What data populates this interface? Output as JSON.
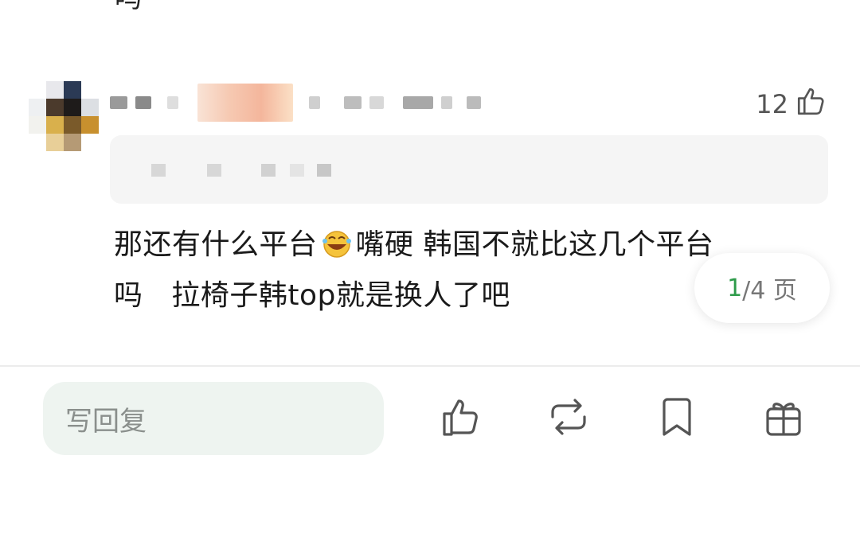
{
  "top_fragment": "吗",
  "comment": {
    "likes": "12",
    "text_before_emoji": "那还有什么平台",
    "text_after_emoji": "嘴硬 韩国不就比这几个平台\n吗   拉椅子韩top就是换人了吧",
    "emoji": "rolling-on-floor-laughing"
  },
  "pager": {
    "current": "1",
    "total": "/4 页"
  },
  "bottom_bar": {
    "reply_placeholder": "写回复",
    "actions": [
      "like-icon",
      "repost-icon",
      "bookmark-icon",
      "gift-icon"
    ]
  },
  "colors": {
    "accent_green": "#2e9b4a",
    "input_bg": "#eef4f0",
    "quote_bg": "#f5f5f5"
  }
}
